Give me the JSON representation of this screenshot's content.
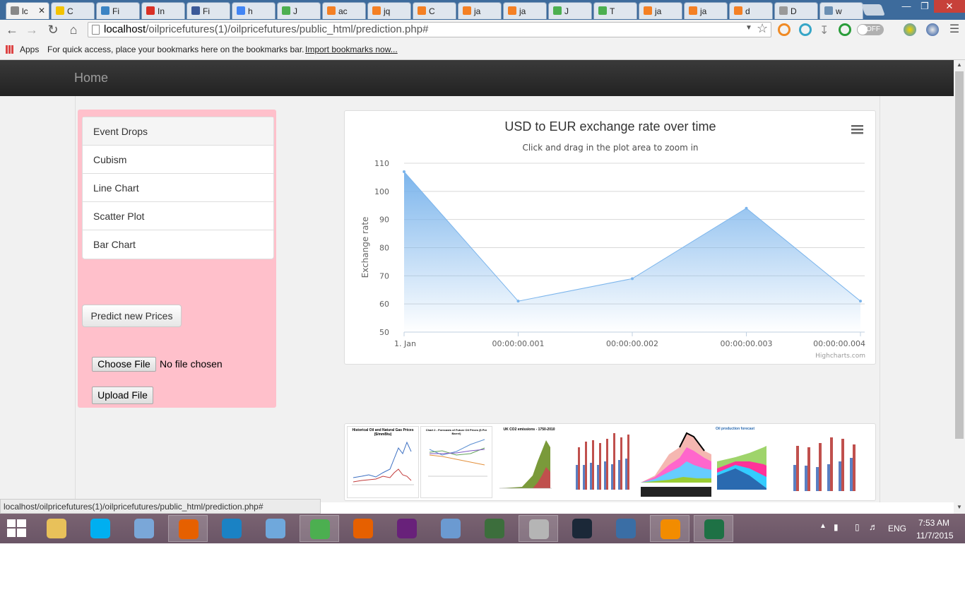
{
  "browser": {
    "tabs": [
      {
        "label": "lc",
        "color": "#888888",
        "active": true
      },
      {
        "label": "C",
        "color": "#f3c300"
      },
      {
        "label": "Fi",
        "color": "#3b84c4"
      },
      {
        "label": "In",
        "color": "#d93025"
      },
      {
        "label": "Fi",
        "color": "#3b5998"
      },
      {
        "label": "h",
        "color": "#4285f4"
      },
      {
        "label": "J",
        "color": "#4caf50"
      },
      {
        "label": "ac",
        "color": "#f48024"
      },
      {
        "label": "jq",
        "color": "#f48024"
      },
      {
        "label": "C",
        "color": "#f48024"
      },
      {
        "label": "ja",
        "color": "#f48024"
      },
      {
        "label": "ja",
        "color": "#f48024"
      },
      {
        "label": "J",
        "color": "#4caf50"
      },
      {
        "label": "T",
        "color": "#4caf50"
      },
      {
        "label": "ja",
        "color": "#f48024"
      },
      {
        "label": "ja",
        "color": "#f48024"
      },
      {
        "label": "d",
        "color": "#f48024"
      },
      {
        "label": "D",
        "color": "#999999"
      },
      {
        "label": "w",
        "color": "#6a8fb3"
      }
    ],
    "url_host": "localhost",
    "url_path": "/oilpricefutures(1)/oilpricefutures/public_html/prediction.php#",
    "toggle_label": "OFF",
    "apps_label": "Apps",
    "bookmarks_hint": "For quick access, place your bookmarks here on the bookmarks bar.",
    "import_link": "Import bookmarks now...",
    "status_url": "localhost/oilpricefutures(1)/oilpricefutures/public_html/prediction.php#"
  },
  "navbar": {
    "brand": "Home"
  },
  "sidebar": {
    "items": [
      {
        "label": "Event Drops"
      },
      {
        "label": "Cubism"
      },
      {
        "label": "Line Chart"
      },
      {
        "label": "Scatter Plot"
      },
      {
        "label": "Bar Chart"
      }
    ],
    "predict_label": "Predict new Prices",
    "choose_file_label": "Choose File",
    "no_file_text": "No file chosen",
    "upload_label": "Upload File"
  },
  "chart_data": {
    "type": "area",
    "title": "USD to EUR exchange rate over time",
    "subtitle": "Click and drag in the plot area to zoom in",
    "xlabel": "",
    "ylabel": "Exchange rate",
    "ylim": [
      50,
      110
    ],
    "yticks": [
      50,
      60,
      70,
      80,
      90,
      100,
      110
    ],
    "x": [
      "1. Jan",
      "00:00:00.001",
      "00:00:00.002",
      "00:00:00.003",
      "00:00:00.004"
    ],
    "series": [
      {
        "values": [
          107,
          61,
          69,
          94,
          61
        ]
      }
    ],
    "grid": true,
    "legend": "none",
    "credits": "Highcharts.com",
    "color": "#7cb5ec"
  },
  "thumbnails": [
    {
      "caption": "Historical Oil and Natural Gas Prices ($/mmBtu)"
    },
    {
      "caption": "Chart 2 - Forecasts of Future Oil Prices ($ Per Barrel)"
    },
    {
      "caption": "UK CO2 emissions - 1750-2010"
    },
    {
      "caption": ""
    },
    {
      "caption": ""
    },
    {
      "caption": "Oil production forecast"
    },
    {
      "caption": ""
    }
  ],
  "taskbar": {
    "apps": [
      {
        "name": "file-explorer",
        "color": "#e8c15a"
      },
      {
        "name": "skype",
        "color": "#00aff0"
      },
      {
        "name": "virtualbox",
        "color": "#7aa7d8"
      },
      {
        "name": "firefox-dev",
        "color": "#e66000",
        "active": true
      },
      {
        "name": "brackets",
        "color": "#1a82c4"
      },
      {
        "name": "safari",
        "color": "#6fa8dc"
      },
      {
        "name": "chrome",
        "color": "#4caf50",
        "active": true
      },
      {
        "name": "firefox",
        "color": "#e66000"
      },
      {
        "name": "visual-studio",
        "color": "#68217a"
      },
      {
        "name": "control-panel",
        "color": "#6b9ad1"
      },
      {
        "name": "game",
        "color": "#3c6e3c"
      },
      {
        "name": "paint",
        "color": "#b5b5b5",
        "active": true
      },
      {
        "name": "steam",
        "color": "#1b2838"
      },
      {
        "name": "thunderbird",
        "color": "#3a6ea5"
      },
      {
        "name": "vlc",
        "color": "#f28c00",
        "active": true
      },
      {
        "name": "excel",
        "color": "#1e7145",
        "active": true
      }
    ],
    "lang": "ENG",
    "time": "7:53 AM",
    "date": "11/7/2015"
  }
}
